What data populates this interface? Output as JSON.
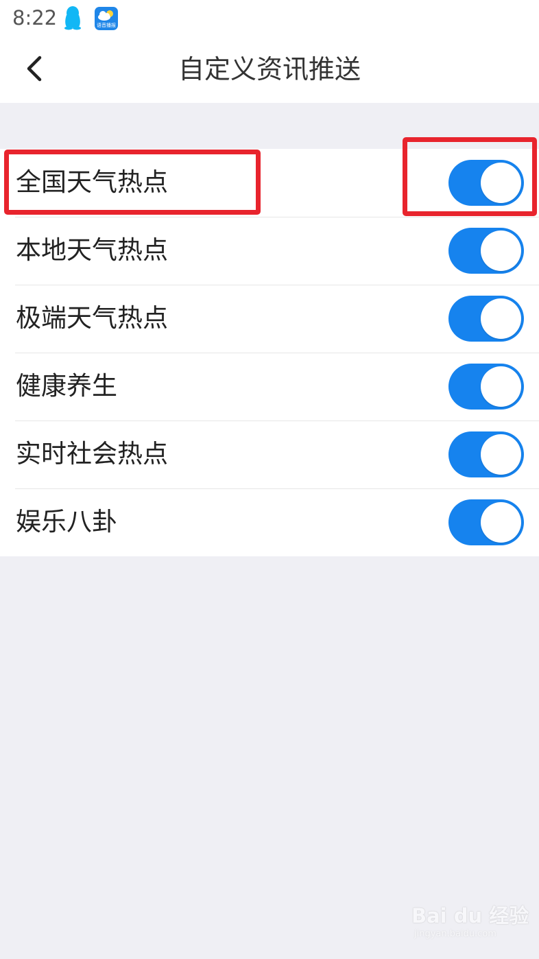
{
  "status_bar": {
    "time": "8:22",
    "icons": [
      "qq-icon",
      "weather-app-icon"
    ],
    "weather_app_label": "语音播报"
  },
  "header": {
    "title": "自定义资讯推送",
    "back_icon": "chevron-left-icon"
  },
  "settings": {
    "items": [
      {
        "label": "全国天气热点",
        "enabled": true
      },
      {
        "label": "本地天气热点",
        "enabled": true
      },
      {
        "label": "极端天气热点",
        "enabled": true
      },
      {
        "label": "健康养生",
        "enabled": true
      },
      {
        "label": "实时社会热点",
        "enabled": true
      },
      {
        "label": "娱乐八卦",
        "enabled": true
      }
    ]
  },
  "watermark": {
    "main": "Bai du 经验",
    "sub": "jingyan.baidu.com"
  },
  "colors": {
    "toggle_on": "#1683ee",
    "highlight": "#e8242d",
    "background": "#efeff4"
  }
}
